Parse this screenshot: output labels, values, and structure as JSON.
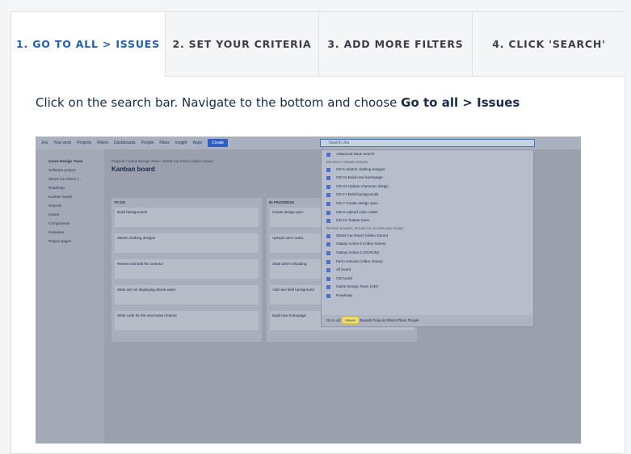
{
  "tabs": [
    {
      "label": "1. GO TO ALL > ISSUES",
      "active": true
    },
    {
      "label": "2. SET YOUR CRITERIA",
      "active": false
    },
    {
      "label": "3. ADD MORE FILTERS",
      "active": false
    },
    {
      "label": "4. CLICK 'SEARCH'",
      "active": false
    }
  ],
  "instruction": {
    "text": "Click on the search bar. Navigate to the bottom and choose ",
    "bold": "Go to all > Issues"
  },
  "screenshot": {
    "topbar": {
      "app": "Jira",
      "nav": [
        "Your work",
        "Projects",
        "Filters",
        "Dashboards",
        "People",
        "Plans",
        "Insight",
        "Apps"
      ],
      "create": "Create",
      "search_placeholder": "Search Jira"
    },
    "sidebar": {
      "project": "Game Design Team",
      "project_sub": "Software project",
      "board": "Street Car Racer (...",
      "items": [
        "Roadmap",
        "Kanban board",
        "Reports",
        "Issues",
        "Components",
        "Releases",
        "Project pages"
      ]
    },
    "breadcrumb": "Projects / Game Design Team / Street Car Racer (Video Game)",
    "title": "Kanban board",
    "columns": [
      {
        "name": "TO DO",
        "cards": [
          "Build backgrounds",
          "Sketch clothing designs",
          "Review and edit the contract",
          "Stats are not displaying above water",
          "Write code for the new button feature"
        ]
      },
      {
        "name": "IN PROGRESS",
        "cards": [
          "Create design spec",
          "Upload color codes",
          "Stats aren't reloading",
          "Add new field background",
          "Build new homepage"
        ]
      }
    ],
    "dropdown": {
      "advanced": "Advanced issue search",
      "section_recent": "RECENTLY VIEWED ISSUES",
      "recent": [
        "GD-5  Sketch clothing designs",
        "GD-24  Build new homepage",
        "GD-23  Update character design",
        "GD-17  Build backgrounds",
        "GD-7  Create design spec",
        "GD-6  Upload color codes",
        "GD-16  Toaster team"
      ],
      "section_boards": "RECENT BOARDS, PROJECTS, FILTERS AND PLANS",
      "boards": [
        "Street Car Racer (Video Game)",
        "Galaxy Action 6 (Video Game)",
        "Galaxy Action 6 (SCRUM)",
        "Farm Harvest (Video Game)",
        "All board",
        "GD board",
        "Game Design Team (GD)",
        "Roadmap"
      ],
      "footer_label": "Go to all:",
      "footer_items": [
        "Issues",
        "Boards",
        "Projects",
        "Filters",
        "Plans",
        "People"
      ]
    }
  }
}
